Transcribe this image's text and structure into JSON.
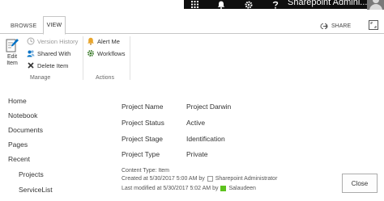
{
  "suite_bar": {
    "user_name": "Sharepoint Admini...",
    "icons": [
      "app-launcher-icon",
      "bell-icon",
      "gear-icon",
      "help-icon"
    ]
  },
  "ribbon": {
    "tabs": [
      {
        "label": "BROWSE",
        "selected": false
      },
      {
        "label": "VIEW",
        "selected": true
      }
    ],
    "share_label": "SHARE",
    "edit_item_label_1": "Edit",
    "edit_item_label_2": "Item",
    "manage": {
      "version_history": "Version History",
      "shared_with": "Shared With",
      "delete_item": "Delete Item",
      "group_label": "Manage"
    },
    "actions": {
      "alert_me": "Alert Me",
      "workflows": "Workflows",
      "group_label": "Actions"
    }
  },
  "left_nav": {
    "items": [
      "Home",
      "Notebook",
      "Documents",
      "Pages",
      "Recent"
    ],
    "recent_items": [
      "Projects",
      "ServiceList"
    ]
  },
  "form": {
    "fields": [
      {
        "label": "Project Name",
        "value": "Project Darwin"
      },
      {
        "label": "Project Status",
        "value": "Active"
      },
      {
        "label": "Project Stage",
        "value": "Identification"
      },
      {
        "label": "Project Type",
        "value": "Private"
      }
    ],
    "content_type": "Content Type: Item",
    "created_text": "Created at 5/30/2017 5:00 AM  by",
    "created_by": "Sharepoint Administrator",
    "modified_text": "Last modified at 5/30/2017 5:02 AM  by",
    "modified_by": "Salaudeen",
    "close_label": "Close"
  },
  "colors": {
    "suite_bar": "#0f0f0f",
    "presence_online": "#5dc21e",
    "accent_blue": "#0072c6"
  }
}
